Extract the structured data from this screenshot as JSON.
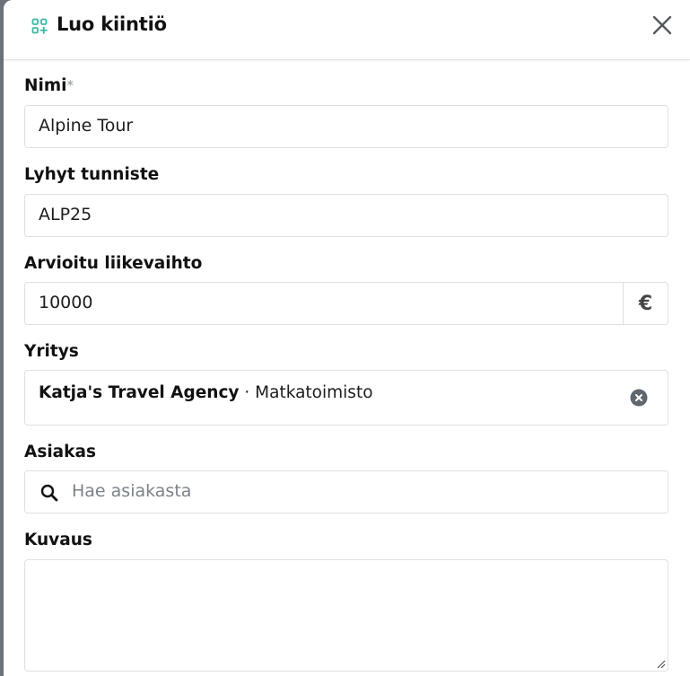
{
  "dialog": {
    "title": "Luo kiintiö",
    "header_icon": "add-grid-icon",
    "close_icon": "close-icon"
  },
  "form": {
    "name": {
      "label": "Nimi",
      "required_mark": "*",
      "value": "Alpine Tour"
    },
    "short_id": {
      "label": "Lyhyt tunniste",
      "value": "ALP25"
    },
    "turnover": {
      "label": "Arvioitu liikevaihto",
      "value": "10000",
      "currency": "€"
    },
    "company": {
      "label": "Yritys",
      "name": "Katja's Travel Agency",
      "separator": " · ",
      "type": "Matkatoimisto",
      "clear_icon": "clear-circle-icon"
    },
    "customer": {
      "label": "Asiakas",
      "placeholder": "Hae asiakasta",
      "search_icon": "search-icon"
    },
    "description": {
      "label": "Kuvaus",
      "value": ""
    }
  },
  "colors": {
    "accent": "#3fb8a5",
    "border": "#dde1e5",
    "text": "#111111",
    "placeholder": "#7b8289"
  }
}
